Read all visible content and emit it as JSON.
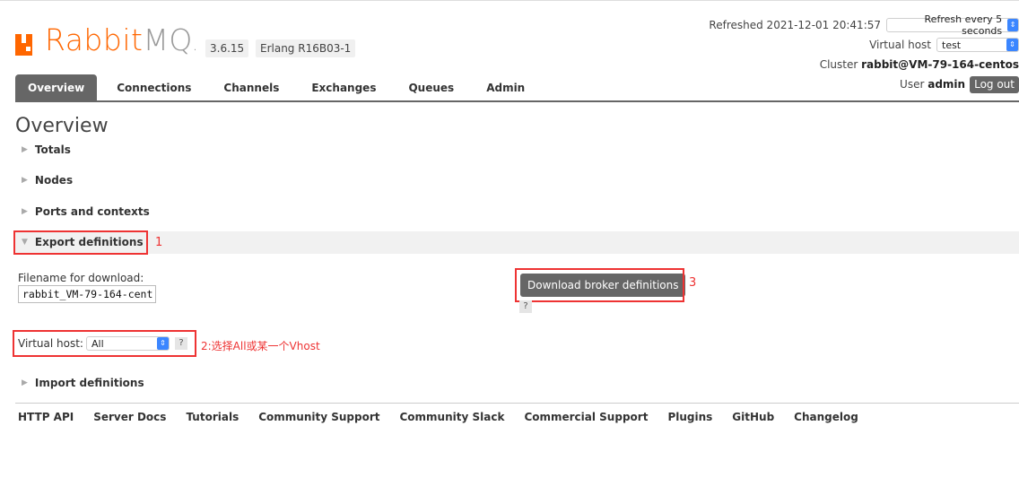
{
  "logo": {
    "brand": "Rabbit",
    "brand_suffix": "MQ",
    "mark": ".",
    "icon": "rabbitmq-logo-icon"
  },
  "version": "3.6.15",
  "erlang": "Erlang R16B03-1",
  "header": {
    "refreshed_label": "Refreshed 2021-12-01 20:41:57",
    "refresh_select": "Refresh every 5 seconds",
    "vhost_label": "Virtual host",
    "vhost_select": "test",
    "cluster_label": "Cluster",
    "cluster_name": "rabbit@VM-79-164-centos",
    "user_label": "User",
    "user_name": "admin",
    "logout_label": "Log out"
  },
  "tabs": [
    "Overview",
    "Connections",
    "Channels",
    "Exchanges",
    "Queues",
    "Admin"
  ],
  "page_title": "Overview",
  "sections": {
    "totals": "Totals",
    "nodes": "Nodes",
    "ports": "Ports and contexts",
    "export": "Export definitions",
    "import": "Import definitions"
  },
  "export": {
    "filename_label": "Filename for download:",
    "filename_value": "rabbit_VM-79-164-cent",
    "download_button": "Download broker definitions",
    "help": "?",
    "vhost_label": "Virtual host:",
    "vhost_value": "All"
  },
  "annotations": {
    "one": "1",
    "two": "2:选择All或某一个Vhost",
    "three": "3",
    "color": "#e33333"
  },
  "footer": [
    "HTTP API",
    "Server Docs",
    "Tutorials",
    "Community Support",
    "Community Slack",
    "Commercial Support",
    "Plugins",
    "GitHub",
    "Changelog"
  ]
}
